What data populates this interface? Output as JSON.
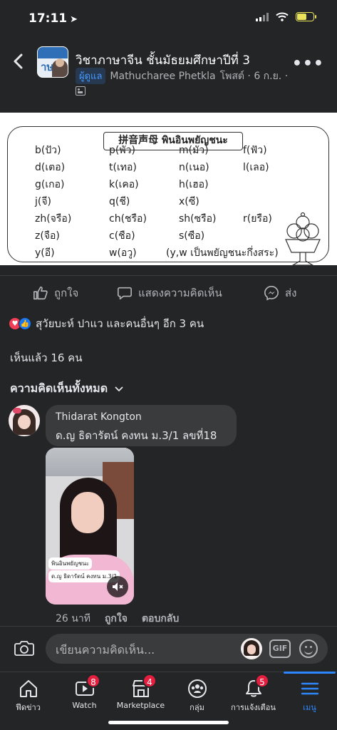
{
  "status_bar": {
    "time": "17:11"
  },
  "post": {
    "group_name": "วิชาภาษาจีน ชั้นมัธยมศึกษาปีที่ 3",
    "admin_badge": "ผู้ดูแล",
    "author": "Mathucharee Phetkla",
    "meta_rest": "โพสต์ · 6 ก.ย. ·",
    "image": {
      "title": "拼音声母 พินอินพยัญชนะ",
      "rows": [
        [
          "b(ปัว)",
          "p(พัว)",
          "m(มัว)",
          "f(ฟัว)"
        ],
        [
          "d(เตอ)",
          "t(เทอ)",
          "n(เนอ)",
          "l(เลอ)"
        ],
        [
          "g(เกอ)",
          "k(เคอ)",
          "h(เฮอ)",
          ""
        ],
        [
          "j(จี)",
          "q(ชี)",
          "x(ซี)",
          ""
        ],
        [
          "zh(จรือ)",
          "ch(ชรือ)",
          "sh(ซรือ)",
          "r(ยรือ)"
        ],
        [
          "z(จือ)",
          "c(ชือ)",
          "s(ซือ)",
          ""
        ],
        [
          "y(อี)",
          "w(อวู)",
          "(y,w เป็นพยัญชนะกึ่งสระ)",
          ""
        ]
      ]
    },
    "actions": {
      "like": "ถูกใจ",
      "comment": "แสดงความคิดเห็น",
      "share": "ส่ง"
    },
    "reactions_text": "สุวัยบะห์ ปาแว และคนอื่นๆ อีก 3 คน",
    "seen_by": "เห็นแล้ว 16 คน",
    "comments_filter": "ความคิดเห็นทั้งหมด"
  },
  "comment": {
    "author": "Thidarat Kongton",
    "text": "ด.ญ ธิดารัตน์ คงทน ม.3/1 ลขที่18",
    "photo_caption_1": "พินอินพยัญชนะ",
    "photo_caption_2": "ด.ญ ธิดารัตน์ คงทน ม.3/1",
    "time": "26 นาที",
    "like": "ถูกใจ",
    "reply": "ตอบกลับ"
  },
  "composer": {
    "placeholder": "เขียนความคิดเห็น...",
    "gif_label": "GIF"
  },
  "tabs": [
    {
      "label": "ฟีดข่าว",
      "badge": ""
    },
    {
      "label": "Watch",
      "badge": "8"
    },
    {
      "label": "Marketplace",
      "badge": "4"
    },
    {
      "label": "กลุ่ม",
      "badge": ""
    },
    {
      "label": "การแจ้งเตือน",
      "badge": "5"
    },
    {
      "label": "เมนู",
      "badge": ""
    }
  ],
  "colors": {
    "accent": "#2d88ff",
    "background": "#242526",
    "badge": "#e41e3f"
  }
}
